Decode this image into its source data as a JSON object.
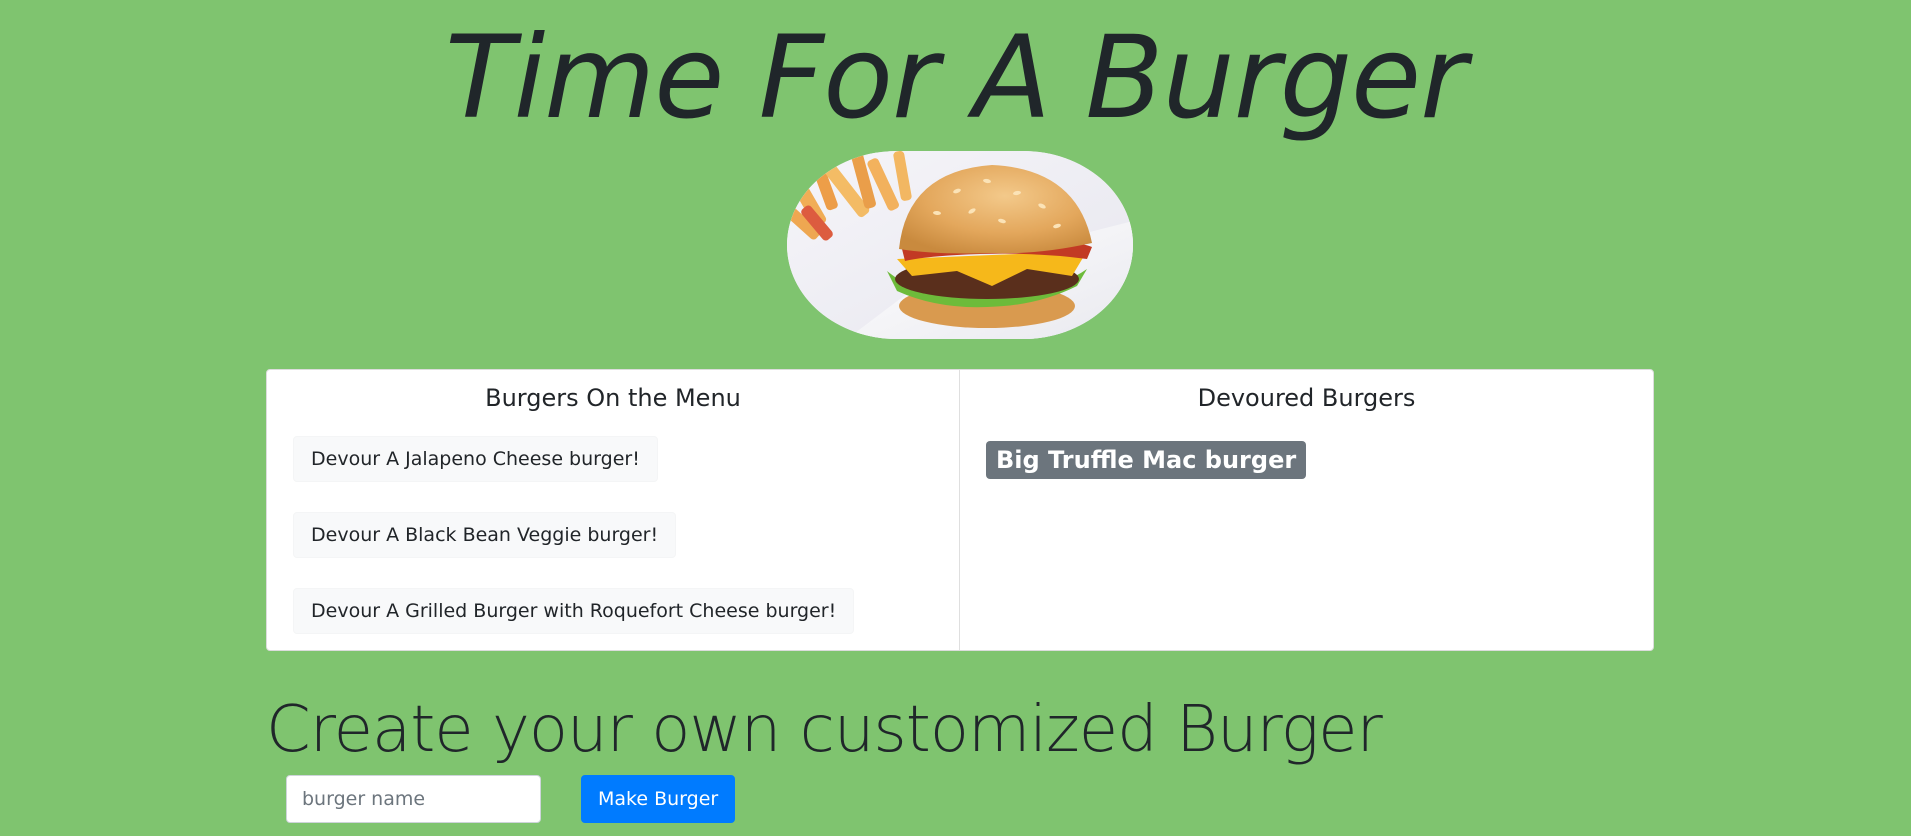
{
  "header": {
    "title": "Time For A Burger"
  },
  "hero": {
    "image": "burger-photo"
  },
  "menu": {
    "title": "Burgers On the Menu",
    "items": [
      {
        "label": "Devour A Jalapeno Cheese burger!"
      },
      {
        "label": "Devour A Black Bean Veggie burger!"
      },
      {
        "label": "Devour A Grilled Burger with Roquefort Cheese burger!"
      }
    ]
  },
  "devoured": {
    "title": "Devoured Burgers",
    "items": [
      {
        "label": "Big Truffle Mac burger"
      }
    ]
  },
  "create": {
    "heading": "Create your own customized Burger",
    "input_value": "",
    "input_placeholder": "burger name",
    "button_label": "Make Burger"
  },
  "colors": {
    "background": "#7fc46f",
    "primary_button": "#007bff",
    "devoured_badge": "#6c757d",
    "menu_button": "#f8f9fa"
  }
}
